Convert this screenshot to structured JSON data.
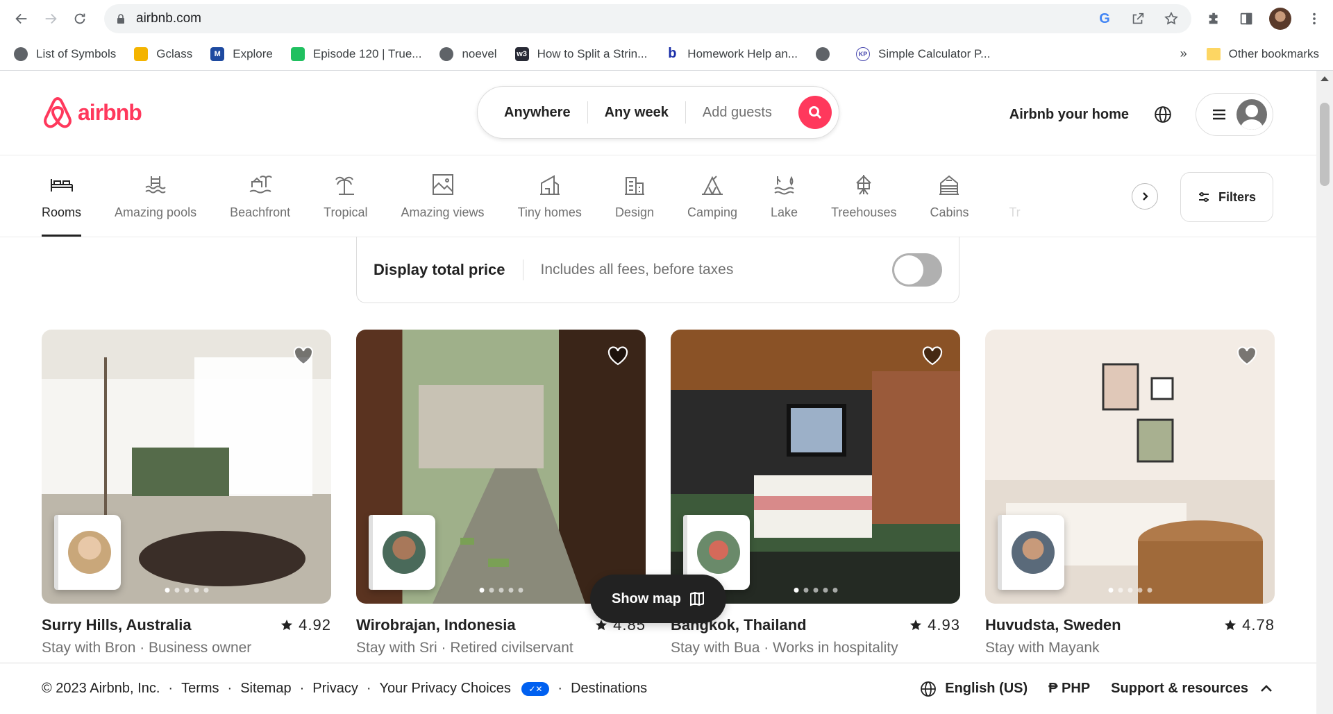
{
  "browser": {
    "url": "airbnb.com",
    "bookmarks": [
      {
        "label": "List of Symbols",
        "icon": "globe-icon"
      },
      {
        "label": "Gclass",
        "icon": "classroom-icon"
      },
      {
        "label": "Explore",
        "icon": "mdl-icon"
      },
      {
        "label": "Episode 120 | True...",
        "icon": "episode-icon"
      },
      {
        "label": "noevel",
        "icon": "globe-icon"
      },
      {
        "label": "How to Split a Strin...",
        "icon": "w3-icon"
      },
      {
        "label": "Homework Help an...",
        "icon": "brainly-icon"
      },
      {
        "label": "",
        "icon": "globe-icon"
      },
      {
        "label": "Simple Calculator P...",
        "icon": "kp-icon"
      }
    ],
    "more": "»",
    "other_bookmarks": "Other bookmarks"
  },
  "header": {
    "logo": "airbnb",
    "search": {
      "anywhere": "Anywhere",
      "any_week": "Any week",
      "guests": "Add guests"
    },
    "host_link": "Airbnb your home"
  },
  "categories": [
    {
      "label": "Rooms",
      "active": true
    },
    {
      "label": "Amazing pools"
    },
    {
      "label": "Beachfront"
    },
    {
      "label": "Tropical"
    },
    {
      "label": "Amazing views"
    },
    {
      "label": "Tiny homes"
    },
    {
      "label": "Design"
    },
    {
      "label": "Camping"
    },
    {
      "label": "Lake"
    },
    {
      "label": "Treehouses"
    },
    {
      "label": "Cabins"
    },
    {
      "label": "Tr"
    }
  ],
  "filters_label": "Filters",
  "price_toggle": {
    "title": "Display total price",
    "subtitle": "Includes all fees, before taxes",
    "enabled": false
  },
  "listings": [
    {
      "location": "Surry Hills, Australia",
      "rating": "4.92",
      "subtitle": "Stay with Bron · Business owner"
    },
    {
      "location": "Wirobrajan, Indonesia",
      "rating": "4.85",
      "subtitle": "Stay with Sri · Retired civilservant"
    },
    {
      "location": "Bangkok, Thailand",
      "rating": "4.93",
      "subtitle": "Stay with Bua · Works in hospitality"
    },
    {
      "location": "Huvudsta, Sweden",
      "rating": "4.78",
      "subtitle": "Stay with Mayank"
    }
  ],
  "show_map": "Show map",
  "footer": {
    "copyright": "© 2023 Airbnb, Inc.",
    "links": [
      "Terms",
      "Sitemap",
      "Privacy",
      "Your Privacy Choices",
      "Destinations"
    ],
    "language": "English (US)",
    "currency": "₱  PHP",
    "support": "Support & resources"
  },
  "colors": {
    "brand": "#ff385c",
    "text": "#222222",
    "muted": "#717171"
  }
}
